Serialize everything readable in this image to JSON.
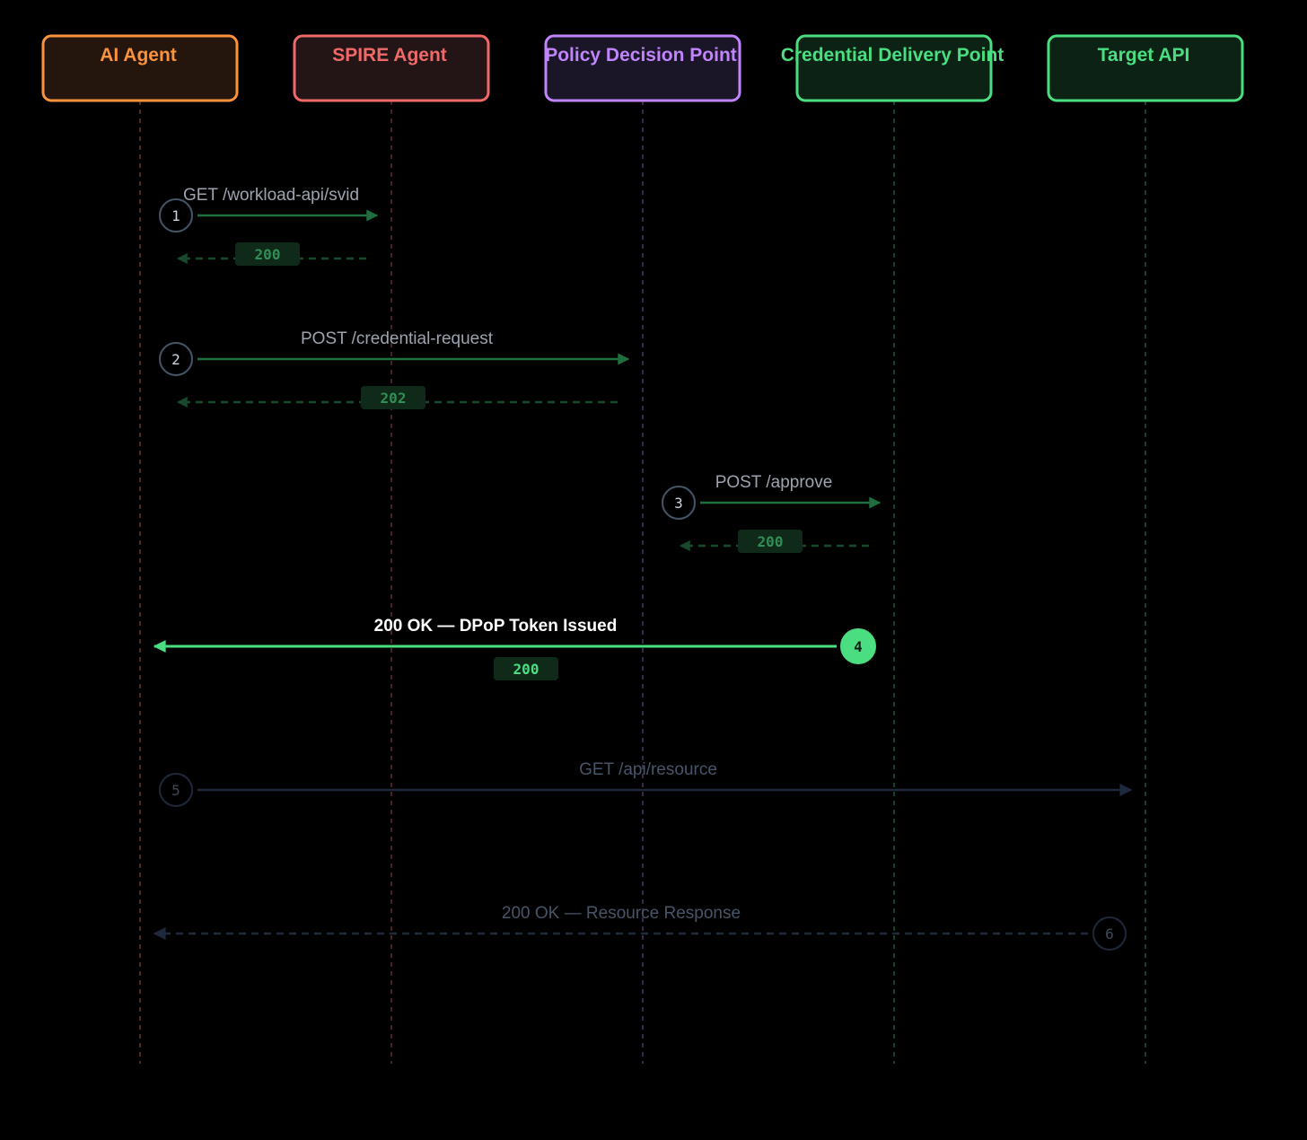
{
  "actors": [
    {
      "id": "ai",
      "label": "AI Agent",
      "color": "#fb923c",
      "fill": "#24160c"
    },
    {
      "id": "spire",
      "label": "SPIRE Agent",
      "color": "#f06969",
      "fill": "#231516"
    },
    {
      "id": "pdp",
      "label": "Policy Decision Point",
      "color": "#c084fc",
      "fill": "#1b1528"
    },
    {
      "id": "cdp",
      "label": "Credential Delivery Point",
      "color": "#4ade80",
      "fill": "#0b2215"
    },
    {
      "id": "api",
      "label": "Target API",
      "color": "#4ade80",
      "fill": "#0b2215"
    }
  ],
  "steps": [
    {
      "num": "1",
      "label": "GET /workload-api/svid",
      "from": "ai",
      "to": "spire",
      "dir": "right",
      "status": "200",
      "state": "done"
    },
    {
      "num": "2",
      "label": "POST /credential-request",
      "from": "ai",
      "to": "pdp",
      "dir": "right",
      "status": "202",
      "state": "done"
    },
    {
      "num": "3",
      "label": "POST /approve",
      "from": "pdp",
      "to": "cdp",
      "dir": "right",
      "status": "200",
      "state": "done"
    },
    {
      "num": "4",
      "label": "200 OK — DPoP Token Issued",
      "from": "cdp",
      "to": "ai",
      "dir": "left",
      "status": "200",
      "state": "active"
    },
    {
      "num": "5",
      "label": "GET /api/resource",
      "from": "ai",
      "to": "api",
      "dir": "right",
      "status": "",
      "state": "pending"
    },
    {
      "num": "6",
      "label": "200 OK — Resource Response",
      "from": "api",
      "to": "ai",
      "dir": "left",
      "status": "",
      "state": "pending"
    }
  ],
  "colors": {
    "done_line": "#1f6f3f",
    "done_num_stroke": "#475569",
    "done_num_text": "#cbd5e1",
    "done_label": "#9ca3af",
    "return_line": "#164a2b",
    "badge_fill": "#0f2a19",
    "badge_text": "#2f8f55",
    "active": "#4ade80",
    "active_label": "#ffffff",
    "active_badge_text": "#4ade80",
    "pending_line": "#1e293b",
    "pending_num_stroke": "#1e293b",
    "pending_num_text": "#3f4a5a",
    "pending_label": "#475569"
  }
}
